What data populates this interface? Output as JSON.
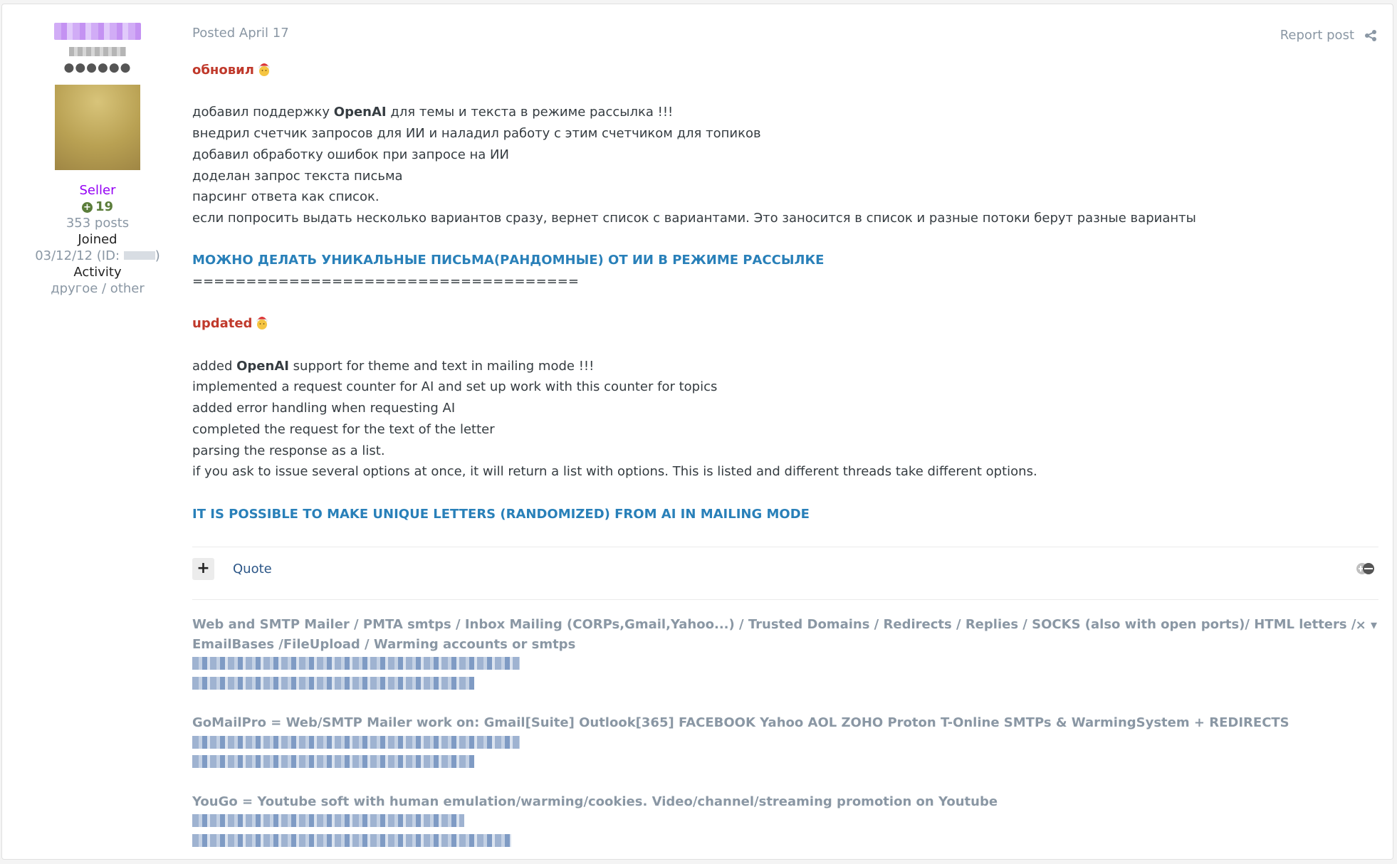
{
  "author": {
    "group": "Seller",
    "reputation": "19",
    "posts": "353 posts",
    "joined_label": "Joined",
    "joined_value_prefix": "03/12/12 (ID: ",
    "joined_value_suffix": ")",
    "activity_label": "Activity",
    "activity_value": "другое / other",
    "rank_dots": "●●●●●●"
  },
  "post": {
    "posted": "Posted April 17",
    "report": "Report post",
    "ru_heading": "обновил",
    "ru_lines": [
      [
        "добавил поддержку ",
        "OpenAI",
        " для темы и текста в режиме рассылка !!!"
      ],
      "внедрил счетчик запросов для ИИ и наладил работу с этим счетчиком для топиков",
      "добавил обработку ошибок при запросе на ИИ",
      "доделан запрос текста письма",
      "парсинг ответа как список.",
      "если попросить выдать несколько вариантов сразу, вернет список с вариантами. Это заносится в список и разные потоки берут разные варианты"
    ],
    "ru_highlight": "МОЖНО ДЕЛАТЬ УНИКАЛЬНЫЕ ПИСЬМА(РАНДОМНЫЕ) ОТ ИИ В РЕЖИМЕ РАССЫЛКЕ",
    "separator": "====================================",
    "en_heading": "updated",
    "en_lines": [
      [
        "added ",
        "OpenAI",
        " support for theme and text in mailing mode !!!"
      ],
      "implemented a request counter for AI and set up work with this counter for topics",
      "added error handling when requesting AI",
      "completed the request for the text of the letter",
      "parsing the response as a list.",
      "if you ask to issue several options at once, it will return a list with options. This is listed and different threads take different options."
    ],
    "en_highlight": "IT IS POSSIBLE TO MAKE UNIQUE LETTERS (RANDOMIZED) FROM AI IN MAILING MODE",
    "quote": "Quote",
    "plus": "+"
  },
  "signature": {
    "controls": "× ▾",
    "blocks": [
      {
        "title_line1": "Web and SMTP Mailer / PMTA smtps / Inbox Mailing (CORPs,Gmail,Yahoo...) / Trusted Domains / Redirects / Replies / SOCKS (also with open ports)/ HTML letters /",
        "title_line2": "EmailBases /FileUpload / Warming accounts or smtps"
      },
      {
        "title_line1": "GoMailPro = Web/SMTP Mailer work on: Gmail[Suite] Outlook[365] FACEBOOK Yahoo AOL ZOHO Proton T-Online SMTPs & WarmingSystem + REDIRECTS"
      },
      {
        "title_line1": "YouGo = Youtube soft with human emulation/warming/cookies. Video/channel/streaming promotion on Youtube"
      }
    ]
  },
  "colors": {
    "group": "#9400f4",
    "reputation": "#5b7d3a",
    "heading_red": "#c0392b",
    "highlight_blue": "#2980b9",
    "muted": "#8a97a4",
    "link": "#2c5687"
  }
}
